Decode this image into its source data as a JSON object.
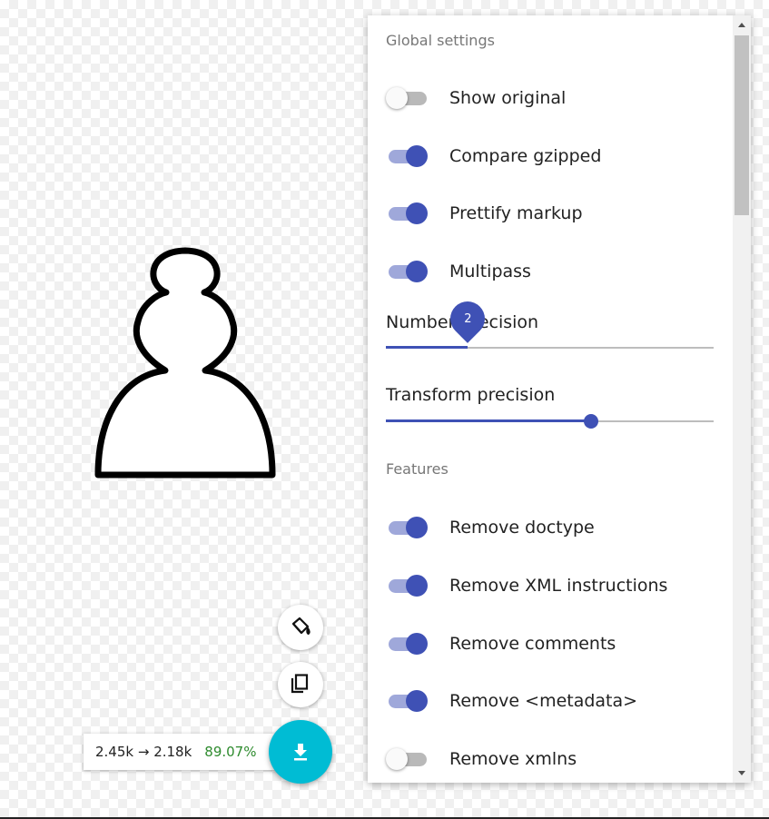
{
  "sizes": {
    "before_after": "2.45k → 2.18k",
    "percent": "89.07%"
  },
  "icons": {
    "paint": "format-paint-icon",
    "copy": "copy-icon",
    "download": "download-icon"
  },
  "colors": {
    "accent": "#3f51b5",
    "accent_light": "#9fa8da",
    "fab": "#00bcd4",
    "positive": "#2e8b2e"
  },
  "global_settings": {
    "title": "Global settings",
    "toggles": [
      {
        "label": "Show original",
        "on": false
      },
      {
        "label": "Compare gzipped",
        "on": true
      },
      {
        "label": "Prettify markup",
        "on": true
      },
      {
        "label": "Multipass",
        "on": true
      }
    ],
    "sliders": [
      {
        "label": "Number precision",
        "value": "2",
        "fraction": 0.25
      },
      {
        "label": "Transform precision",
        "fraction": 0.625
      }
    ]
  },
  "features": {
    "title": "Features",
    "toggles": [
      {
        "label": "Remove doctype",
        "on": true
      },
      {
        "label": "Remove XML instructions",
        "on": true
      },
      {
        "label": "Remove comments",
        "on": true
      },
      {
        "label": "Remove <metadata>",
        "on": true
      },
      {
        "label": "Remove xmlns",
        "on": false
      }
    ]
  }
}
